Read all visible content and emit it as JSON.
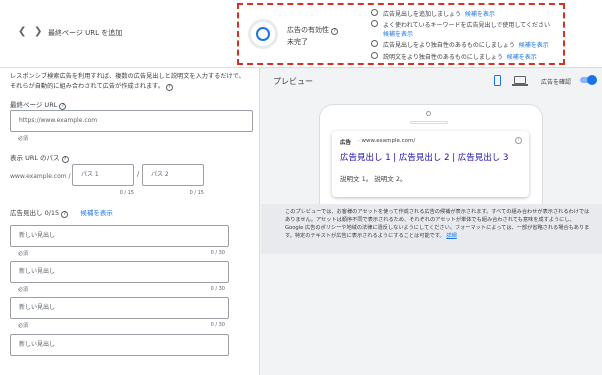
{
  "header": {
    "back_icon": "chevron-left-icon",
    "forward_icon": "chevron-right-icon",
    "title": "最終ページ URL を追加"
  },
  "ad_strength": {
    "label": "広告の有効性",
    "status": "未完了",
    "suggestions": [
      {
        "text": "広告見出しを追加しましょう",
        "link": "候補を表示"
      },
      {
        "text": "よく使われているキーワードを広告見出しで使用してください",
        "link": "候補を表示"
      },
      {
        "text": "広告見出しをより独自性のあるものにしましょう",
        "link": "候補を表示"
      },
      {
        "text": "説明文をより独自性のあるものにしましょう",
        "link": "候補を表示"
      }
    ],
    "accent": "#d93025"
  },
  "form": {
    "intro": "レスポンシブ検索広告を利用すれば、複数の広告見出しと説明文を入力するだけで、それらが自動的に組み合わされて広告が作成されます。",
    "final_url": {
      "label": "最終ページ URL",
      "placeholder": "https://www.example.com",
      "helper": "必須"
    },
    "display_path": {
      "label": "表示 URL のパス",
      "domain": "www.example.com",
      "slash": "/",
      "path1_placeholder": "パス 1",
      "path2_placeholder": "パス 2",
      "counter1": "0 / 15",
      "counter2": "0 / 15"
    },
    "headlines": {
      "label": "広告見出し 0/15",
      "link": "候補を表示",
      "items": [
        {
          "placeholder": "新しい見出し",
          "helper": "必須",
          "counter": "0 / 30"
        },
        {
          "placeholder": "新しい見出し",
          "helper": "必須",
          "counter": "0 / 30"
        },
        {
          "placeholder": "新しい見出し",
          "helper": "必須",
          "counter": "0 / 30"
        },
        {
          "placeholder": "新しい見出し",
          "helper": "",
          "counter": ""
        }
      ]
    }
  },
  "preview": {
    "title": "プレビュー",
    "mobile_icon": "smartphone-icon",
    "desktop_icon": "desktop-icon",
    "rotate_label": "広告を確認",
    "ad": {
      "badge": "広告",
      "url": "www.example.com/",
      "headline": "広告見出し 1 | 広告見出し 2 | 広告見出し 3",
      "description": "説明文 1。 説明文 2。"
    },
    "disclaimer": "このプレビューでは、お客様のアセットを使って作成される広告の候補が表示されます。すべての組み合わせが表示されるわけではありません。アセットは順序不同で表示されるため、それぞれのアセットが単体でも組み合わされても意味を成すようにし、Google 広告のポリシーや地域の法律に違反しないようにしてください。フォーマットによっては、一部が省略される場合もあります。特定のテキストが広告に表示されるようにすることは可能です。",
    "disclaimer_link": "詳細"
  }
}
